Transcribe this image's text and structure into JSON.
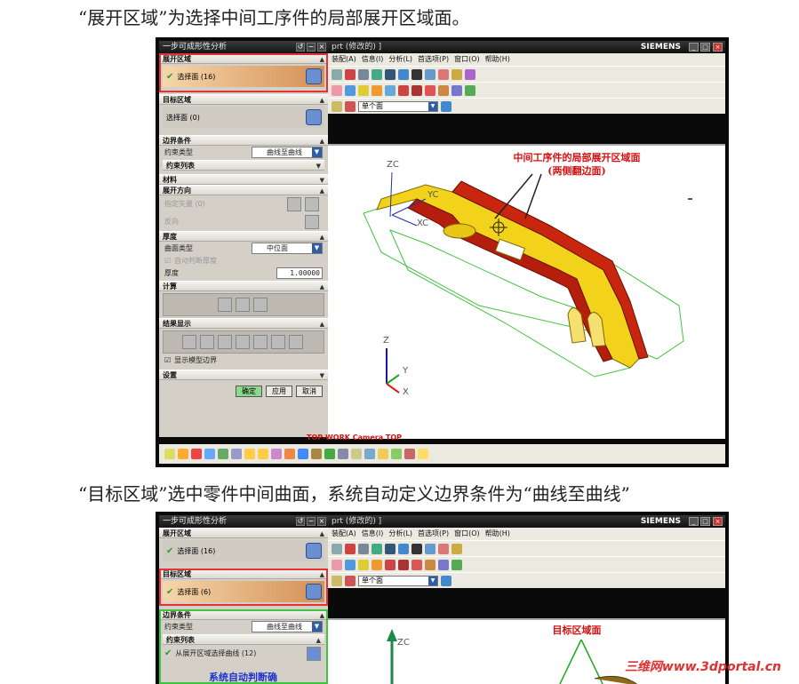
{
  "captions": {
    "top": "“展开区域”为选择中间工序件的局部展开区域面。",
    "middle": "“目标区域”选中零件中间曲面，系统自动定义边界条件为“曲线至曲线”"
  },
  "dialog": {
    "title": "一步可成形性分析",
    "sections": {
      "unfold": "展开区域",
      "target": "目标区域",
      "boundary": "边界条件",
      "constraint_list": "约束列表",
      "material": "材料",
      "direction": "展开方向",
      "thickness": "厚度",
      "compute": "计算",
      "results": "结果显示",
      "settings": "设置"
    },
    "fig1": {
      "unfold_select": "选择面 (16)",
      "target_select": "选择面 (0)"
    },
    "fig2": {
      "unfold_select": "选择面 (16)",
      "target_select": "选择面 (6)",
      "from_curve": "从展开区域选择曲线 (12)",
      "note": "系统自动判断确"
    },
    "constraint_type_label": "约束类型",
    "constraint_type_value": "曲线至曲线",
    "vector_label": "指定矢量 (0)",
    "reverse_label": "反向",
    "surface_type_label": "曲面类型",
    "surface_type_value": "中位面",
    "auto_thickness_label": "自动判断厚度",
    "thickness_label": "厚度",
    "thickness_value": "1.00000",
    "show_boundary_label": "显示模型边界",
    "ok": "确定",
    "apply": "应用",
    "cancel": "取消"
  },
  "app": {
    "title": "prt (修改的) ]",
    "brand": "SIEMENS",
    "menu": [
      "装配(A)",
      "信息(I)",
      "分析(L)",
      "首选项(P)",
      "窗口(O)",
      "帮助(H)"
    ],
    "filter_value": "单个面",
    "view_label": "TOP-WORK Camera TOP"
  },
  "viewport": {
    "fig1_annotation_line1": "中间工序件的局部展开区域面",
    "fig1_annotation_line2": "(两侧翻边面)",
    "fig2_annotation": "目标区域面",
    "axes": {
      "zc": "ZC",
      "yc": "YC",
      "xc": "XC",
      "z": "Z",
      "y": "Y",
      "x": "X"
    }
  },
  "watermark": "三维网www.3dportal.cn",
  "colors": {
    "highlight_red": "#e53333",
    "highlight_green": "#3ec43e",
    "part_yellow": "#f2d21b",
    "part_red": "#c8260f",
    "annotation_red": "#d41111"
  }
}
